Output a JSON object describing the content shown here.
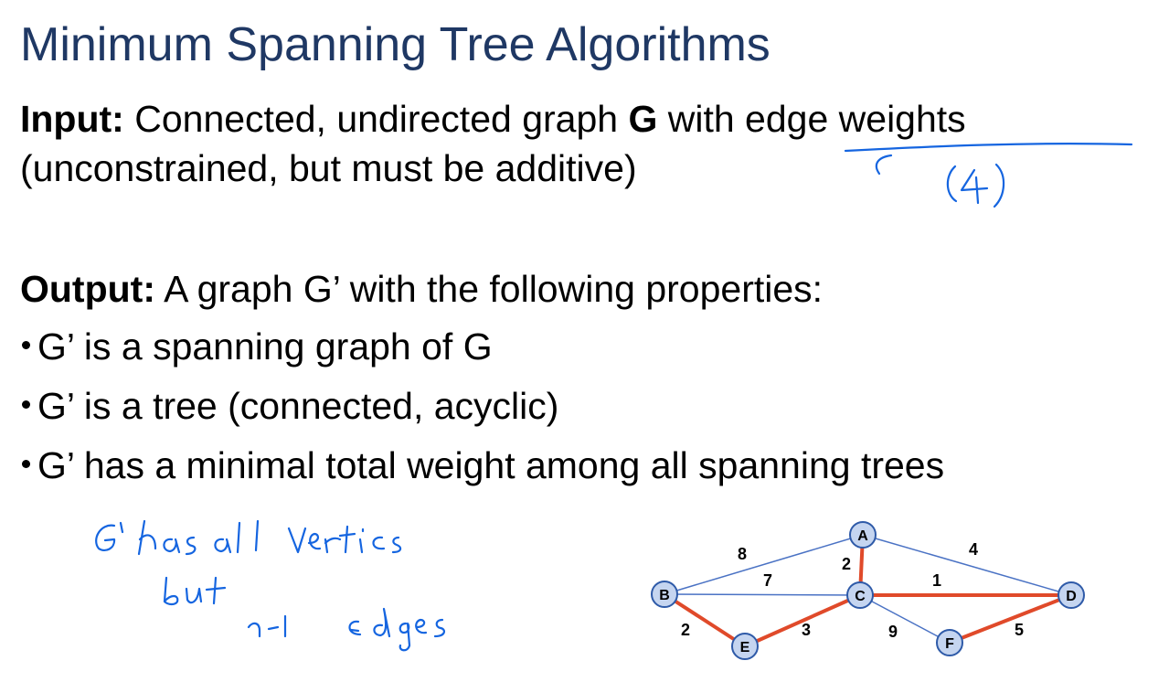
{
  "title": "Minimum Spanning Tree Algorithms",
  "input": {
    "label": "Input:",
    "text_before": " Connected, undirected graph ",
    "graph_symbol": "G",
    "text_after": " with edge weights",
    "line2": "(unconstrained, but must be additive)"
  },
  "output": {
    "label": "Output:",
    "text": " A graph G’ with the following properties:"
  },
  "bullets": [
    "G’ is a spanning graph of G",
    "G’ is a tree (connected, acyclic)",
    "G’ has a minimal total weight among all spanning trees"
  ],
  "graph": {
    "nodes": [
      "A",
      "B",
      "C",
      "D",
      "E",
      "F"
    ],
    "edge_weights": [
      "8",
      "2",
      "4",
      "7",
      "1",
      "2",
      "3",
      "9",
      "5"
    ]
  },
  "colors": {
    "title": "#1f3864",
    "tree_edge": "#e04a2a",
    "graph_edge": "#4a72c4",
    "node_fill": "#c5d5f0",
    "ink": "#1565e0"
  }
}
